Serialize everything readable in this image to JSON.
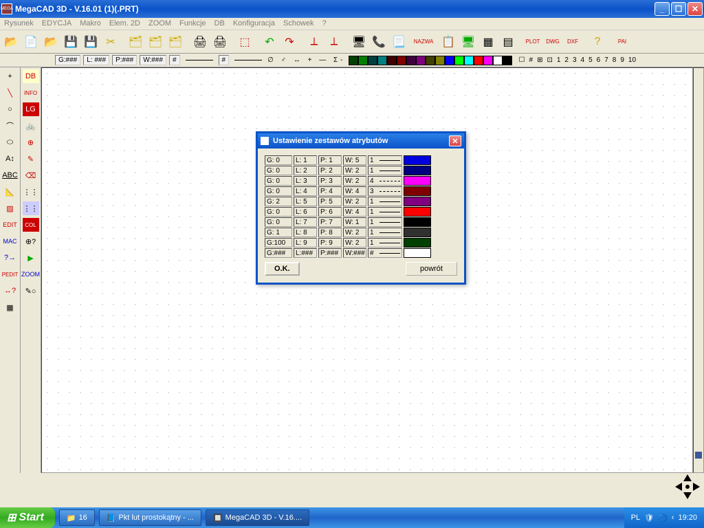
{
  "window": {
    "title": "MegaCAD 3D - V.16.01 (1)(.PRT)",
    "app_icon_text": "MEGA"
  },
  "menu": [
    "Rysunek",
    "EDYCJA",
    "Makro",
    "Elem. 2D",
    "ZOOM",
    "Funkcje",
    "DB",
    "Konfiguracja",
    "Schowek",
    "?"
  ],
  "infobar": {
    "g": "G:###",
    "l": "L: ###",
    "p": "P:###",
    "w": "W:###",
    "hash1": "#",
    "hash2": "#",
    "symbols": "∅ ♂ ↔ + — Σ-",
    "palette": [
      "#004000",
      "#008000",
      "#004040",
      "#008080",
      "#400000",
      "#800000",
      "#400040",
      "#800080",
      "#404000",
      "#808000",
      "#0000ff",
      "#00ff00",
      "#00ffff",
      "#ff0000",
      "#ff00ff",
      "#ffffff",
      "#000000"
    ],
    "extras": [
      "☐",
      "#",
      "⊞",
      "⊡",
      "1",
      "2",
      "3",
      "4",
      "5",
      "6",
      "7",
      "8",
      "9",
      "10"
    ]
  },
  "dialog": {
    "title": "Ustawienie zestawów atrybutów",
    "ok": "O.K.",
    "cancel": "powrót",
    "rows": [
      {
        "g": "G:  0",
        "l": "L:  1",
        "p": "P:  1",
        "w": "W:  5",
        "lt": "1",
        "line": "solid",
        "color": "#0000e0"
      },
      {
        "g": "G:  0",
        "l": "L:  2",
        "p": "P:  2",
        "w": "W:  2",
        "lt": "1",
        "line": "solid",
        "color": "#000080"
      },
      {
        "g": "G:  0",
        "l": "L:  3",
        "p": "P:  3",
        "w": "W:  2",
        "lt": "4",
        "line": "dash",
        "color": "#ff00ff"
      },
      {
        "g": "G:  0",
        "l": "L:  4",
        "p": "P:  4",
        "w": "W:  4",
        "lt": "3",
        "line": "dash",
        "color": "#800000"
      },
      {
        "g": "G:  2",
        "l": "L:  5",
        "p": "P:  5",
        "w": "W:  2",
        "lt": "1",
        "line": "solid",
        "color": "#800080"
      },
      {
        "g": "G:  0",
        "l": "L:  6",
        "p": "P:  6",
        "w": "W:  4",
        "lt": "1",
        "line": "solid",
        "color": "#ff0000"
      },
      {
        "g": "G:  0",
        "l": "L:  7",
        "p": "P:  7",
        "w": "W:  1",
        "lt": "1",
        "line": "solid",
        "color": "#000000"
      },
      {
        "g": "G:  1",
        "l": "L:  8",
        "p": "P:  8",
        "w": "W:  2",
        "lt": "1",
        "line": "solid",
        "color": "#303030"
      },
      {
        "g": "G:100",
        "l": "L:  9",
        "p": "P:  9",
        "w": "W:  2",
        "lt": "1",
        "line": "solid",
        "color": "#004000"
      },
      {
        "g": "G:###",
        "l": "L:###",
        "p": "P:###",
        "w": "W:###",
        "lt": "#",
        "line": "solid",
        "color": "#ffffff"
      }
    ]
  },
  "taskbar": {
    "start": "Start",
    "items": [
      "16",
      "Pkt lut prostokątny - ...",
      "MegaCAD 3D - V.16...."
    ],
    "lang": "PL",
    "time": "19:20"
  }
}
